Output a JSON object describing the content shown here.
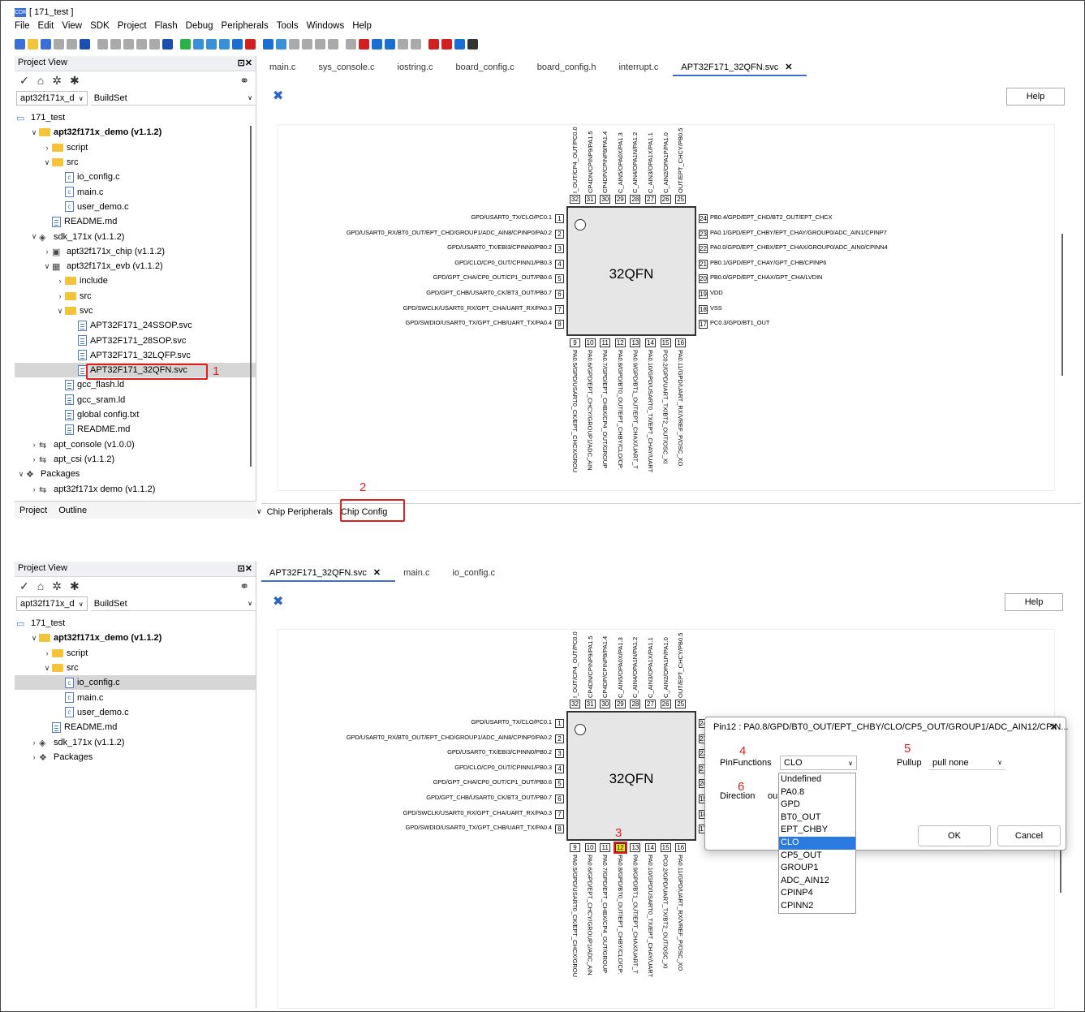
{
  "window": {
    "title": "[ 171_test ]",
    "app_icon": "CDK"
  },
  "menu": [
    "File",
    "Edit",
    "View",
    "SDK",
    "Project",
    "Flash",
    "Debug",
    "Peripherals",
    "Tools",
    "Windows",
    "Help"
  ],
  "project_view": {
    "title": "Project View",
    "combo_project": "apt32f171x_d",
    "combo_buildset": "BuildSet",
    "bottom_tabs": [
      "Project",
      "Outline"
    ]
  },
  "tree_top": [
    {
      "label": "171_test",
      "icon": "workspace",
      "indent": 0,
      "chev": ""
    },
    {
      "label": "apt32f171x_demo (v1.1.2)",
      "icon": "folder",
      "indent": 1,
      "chev": "v",
      "bold": true
    },
    {
      "label": "script",
      "icon": "folder",
      "indent": 2,
      "chev": ">"
    },
    {
      "label": "src",
      "icon": "folder",
      "indent": 2,
      "chev": "v"
    },
    {
      "label": "io_config.c",
      "icon": "c",
      "indent": 3,
      "chev": ""
    },
    {
      "label": "main.c",
      "icon": "c",
      "indent": 3,
      "chev": ""
    },
    {
      "label": "user_demo.c",
      "icon": "c",
      "indent": 3,
      "chev": ""
    },
    {
      "label": "README.md",
      "icon": "file",
      "indent": 2,
      "chev": ""
    },
    {
      "label": "sdk_171x (v1.1.2)",
      "icon": "sdk",
      "indent": 1,
      "chev": "v"
    },
    {
      "label": "apt32f171x_chip (v1.1.2)",
      "icon": "chip",
      "indent": 2,
      "chev": ">"
    },
    {
      "label": "apt32f171x_evb (v1.1.2)",
      "icon": "board",
      "indent": 2,
      "chev": "v"
    },
    {
      "label": "include",
      "icon": "folder",
      "indent": 3,
      "chev": ">"
    },
    {
      "label": "src",
      "icon": "folder",
      "indent": 3,
      "chev": ">"
    },
    {
      "label": "svc",
      "icon": "folder",
      "indent": 3,
      "chev": "v"
    },
    {
      "label": "APT32F171_24SSOP.svc",
      "icon": "file",
      "indent": 4,
      "chev": ""
    },
    {
      "label": "APT32F171_28SOP.svc",
      "icon": "file",
      "indent": 4,
      "chev": ""
    },
    {
      "label": "APT32F171_32LQFP.svc",
      "icon": "file",
      "indent": 4,
      "chev": ""
    },
    {
      "label": "APT32F171_32QFN.svc",
      "icon": "file",
      "indent": 4,
      "chev": "",
      "selected": true
    },
    {
      "label": "gcc_flash.ld",
      "icon": "file",
      "indent": 3,
      "chev": ""
    },
    {
      "label": "gcc_sram.ld",
      "icon": "file",
      "indent": 3,
      "chev": ""
    },
    {
      "label": "global config.txt",
      "icon": "file",
      "indent": 3,
      "chev": ""
    },
    {
      "label": "README.md",
      "icon": "file",
      "indent": 3,
      "chev": ""
    },
    {
      "label": "apt_console (v1.0.0)",
      "icon": "pkg",
      "indent": 1,
      "chev": ">"
    },
    {
      "label": "apt_csi (v1.1.2)",
      "icon": "pkg",
      "indent": 1,
      "chev": ">"
    },
    {
      "label": "Packages",
      "icon": "packages",
      "indent": 0,
      "chev": "v"
    },
    {
      "label": "apt32f171x demo (v1.1.2)",
      "icon": "pkg",
      "indent": 1,
      "chev": ">"
    }
  ],
  "tree_bottom": [
    {
      "label": "171_test",
      "icon": "workspace",
      "indent": 0,
      "chev": ""
    },
    {
      "label": "apt32f171x_demo (v1.1.2)",
      "icon": "folder",
      "indent": 1,
      "chev": "v",
      "bold": true
    },
    {
      "label": "script",
      "icon": "folder",
      "indent": 2,
      "chev": ">"
    },
    {
      "label": "src",
      "icon": "folder",
      "indent": 2,
      "chev": "v"
    },
    {
      "label": "io_config.c",
      "icon": "c",
      "indent": 3,
      "chev": "",
      "selected": true
    },
    {
      "label": "main.c",
      "icon": "c",
      "indent": 3,
      "chev": ""
    },
    {
      "label": "user_demo.c",
      "icon": "c",
      "indent": 3,
      "chev": ""
    },
    {
      "label": "README.md",
      "icon": "file",
      "indent": 2,
      "chev": ""
    },
    {
      "label": "sdk_171x (v1.1.2)",
      "icon": "sdk",
      "indent": 1,
      "chev": ">"
    },
    {
      "label": "Packages",
      "icon": "packages",
      "indent": 1,
      "chev": ">"
    }
  ],
  "editor_tabs_top": [
    {
      "label": "main.c"
    },
    {
      "label": "sys_console.c"
    },
    {
      "label": "iostring.c"
    },
    {
      "label": "board_config.c"
    },
    {
      "label": "board_config.h"
    },
    {
      "label": "interrupt.c"
    },
    {
      "label": "APT32F171_32QFN.svc",
      "active": true,
      "close": "✕"
    }
  ],
  "editor_tabs_bottom": [
    {
      "label": "APT32F171_32QFN.svc",
      "active": true,
      "close": "✕"
    },
    {
      "label": "main.c"
    },
    {
      "label": "io_config.c"
    }
  ],
  "help_label": "Help",
  "chip_tabs": [
    "Chip Peripherals",
    "Chip Config"
  ],
  "chip": {
    "name": "32QFN",
    "left_pins": [
      {
        "n": "1",
        "label": "GPD/USART0_TX/CLO/PC0.1"
      },
      {
        "n": "2",
        "label": "GPD/USART0_RX/BT0_OUT/EPT_CHD/GROUP1/ADC_AIN8/CPINP0/PA0.2"
      },
      {
        "n": "3",
        "label": "GPD/USART0_TX/EBI3/CPINN0/PB0.2"
      },
      {
        "n": "4",
        "label": "GPD/CLO/CP0_OUT/CPINN1/PB0.3"
      },
      {
        "n": "5",
        "label": "GPD/GPT_CHA/CP0_OUT/CP1_OUT/PB0.6"
      },
      {
        "n": "6",
        "label": "GPD/GPT_CHB/USART0_CK/BT3_OUT/PB0.7"
      },
      {
        "n": "7",
        "label": "GPD/SWCLK/USART0_RX/GPT_CHA/UART_RX/PA0.3"
      },
      {
        "n": "8",
        "label": "GPD/SWDIO/USART0_TX/GPT_CHB/UART_TX/PA0.4"
      }
    ],
    "right_pins": [
      {
        "n": "24",
        "label": "PB0.4/GPD/EPT_CHD/BT2_OUT/EPT_CHCX"
      },
      {
        "n": "23",
        "label": "PA0.1/GPD/EPT_CHBY/EPT_CHAY/GROUP0/ADC_AIN1/CPINP7"
      },
      {
        "n": "22",
        "label": "PA0.0/GPD/EPT_CHBX/EPT_CHAX/GROUP0/ADC_AIN0/CPINN4"
      },
      {
        "n": "21",
        "label": "PB0.1/GPD/EPT_CHAY/GPT_CHB/CPINP6"
      },
      {
        "n": "20",
        "label": "PB0.0/GPD/EPT_CHAX/GPT_CHA/LVDIN"
      },
      {
        "n": "19",
        "label": "VDD"
      },
      {
        "n": "18",
        "label": "VSS"
      },
      {
        "n": "17",
        "label": "PC0.3/GPD/BT1_OUT"
      }
    ],
    "top_pins": [
      {
        "n": "32",
        "label": "I_OUT/CP4_OUT/PC0.0"
      },
      {
        "n": "31",
        "label": "CP4DN/CPINP9/PA1.5"
      },
      {
        "n": "30",
        "label": "CP4DP/CPINP8/PA1.4"
      },
      {
        "n": "29",
        "label": "C_AIN5/OPA0X/PA1.3"
      },
      {
        "n": "28",
        "label": "C_AIN4/OPA1N/PA1.2"
      },
      {
        "n": "27",
        "label": "C_AIN3/OPA1X/PA1.1"
      },
      {
        "n": "26",
        "label": "C_AIN2/OPA1P/PA1.0"
      },
      {
        "n": "25",
        "label": "OUT/EPT_CHCY/PB0.5"
      }
    ],
    "bottom_pins": [
      {
        "n": "9",
        "label": "PA0.5/GPD/USART0_CK/EPT_CHCX/GROU"
      },
      {
        "n": "10",
        "label": "PA0.6/GPD/EPT_CHCY/GROUP1/ADC_AIN"
      },
      {
        "n": "11",
        "label": "PA0.7/GPD/EPT_CHBX/CP4_OUT/GROUP"
      },
      {
        "n": "12",
        "label": "PA0.8/GPD/BT0_OUT/EPT_CHBY/CLO/CP:"
      },
      {
        "n": "13",
        "label": "PA0.9/GPD/BT1_OUT/EPT_CHAX/UART_T"
      },
      {
        "n": "14",
        "label": "PA0.10/GPD/USART0_TX/EPT_CHAY/UART"
      },
      {
        "n": "15",
        "label": "PC0.2/GPD/UART_TX/BT2_OUT/OSC_XI"
      },
      {
        "n": "16",
        "label": "PA0.11/GPD/UART_RX/VREF_P/OSC_XO"
      }
    ]
  },
  "dialog": {
    "title": "Pin12 : PA0.8/GPD/BT0_OUT/EPT_CHBY/CLO/CP5_OUT/GROUP1/ADC_AIN12/CPIN...",
    "close": "✕",
    "pinfunctions_label": "PinFunctions",
    "pinfunctions_value": "CLO",
    "pullup_label": "Pullup",
    "pullup_value": "pull none",
    "direction_label": "Direction",
    "direction_value": "ou",
    "ok": "OK",
    "cancel": "Cancel",
    "options": [
      "Undefined",
      "PA0.8",
      "GPD",
      "BT0_OUT",
      "EPT_CHBY",
      "CLO",
      "CP5_OUT",
      "GROUP1",
      "ADC_AIN12",
      "CPINP4",
      "CPINN2"
    ],
    "selected_option": "CLO"
  },
  "annotations": [
    "1",
    "2",
    "3",
    "4",
    "5",
    "6"
  ],
  "colors": {
    "annotation": "#e02020",
    "accent": "#2a7ae2",
    "highlight_pin": "#f5e400"
  }
}
